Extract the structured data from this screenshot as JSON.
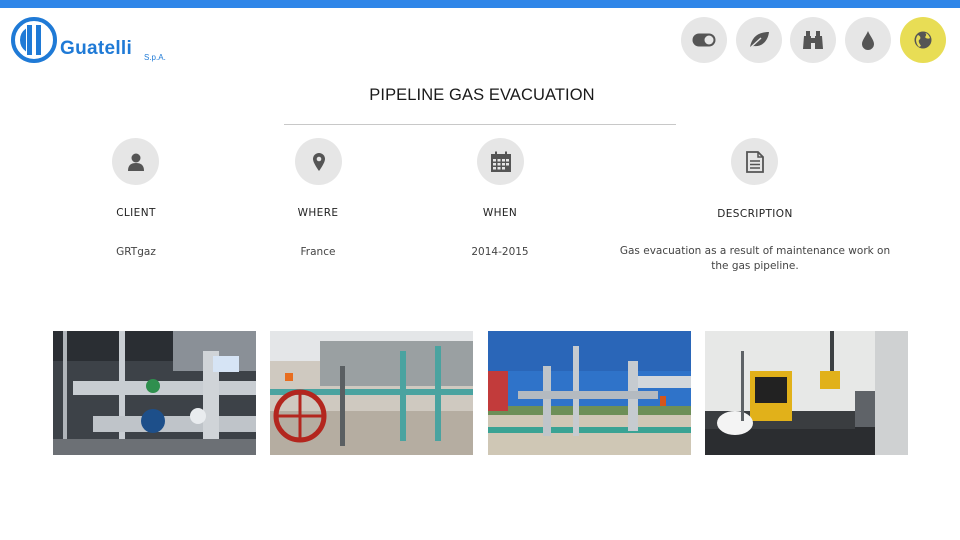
{
  "brand": {
    "name": "Guatelli",
    "suffix": "S.p.A.",
    "color": "#1f7ad6"
  },
  "header": {
    "accent_color": "#2f86e8",
    "nav": [
      {
        "icon": "toggle-icon",
        "active": false
      },
      {
        "icon": "leaf-icon",
        "active": false
      },
      {
        "icon": "binoculars-icon",
        "active": false
      },
      {
        "icon": "drop-icon",
        "active": false
      },
      {
        "icon": "globe-icon",
        "active": true
      }
    ],
    "active_color": "#e8dd55"
  },
  "page": {
    "title": "PIPELINE GAS EVACUATION"
  },
  "info": {
    "client": {
      "label": "CLIENT",
      "value": "GRTgaz",
      "icon": "user-icon"
    },
    "where": {
      "label": "WHERE",
      "value": "France",
      "icon": "location-pin-icon"
    },
    "when": {
      "label": "WHEN",
      "value": "2014-2015",
      "icon": "calendar-icon"
    },
    "description": {
      "label": "DESCRIPTION",
      "value": "Gas evacuation as a result of maintenance work on the gas pipeline.",
      "icon": "document-icon"
    }
  },
  "gallery": [
    {
      "subject": "pipeline-valves-closeup"
    },
    {
      "subject": "red-handwheel-valve-site"
    },
    {
      "subject": "pipeline-station-blue-sky"
    },
    {
      "subject": "yellow-instrument-cases-container"
    }
  ]
}
